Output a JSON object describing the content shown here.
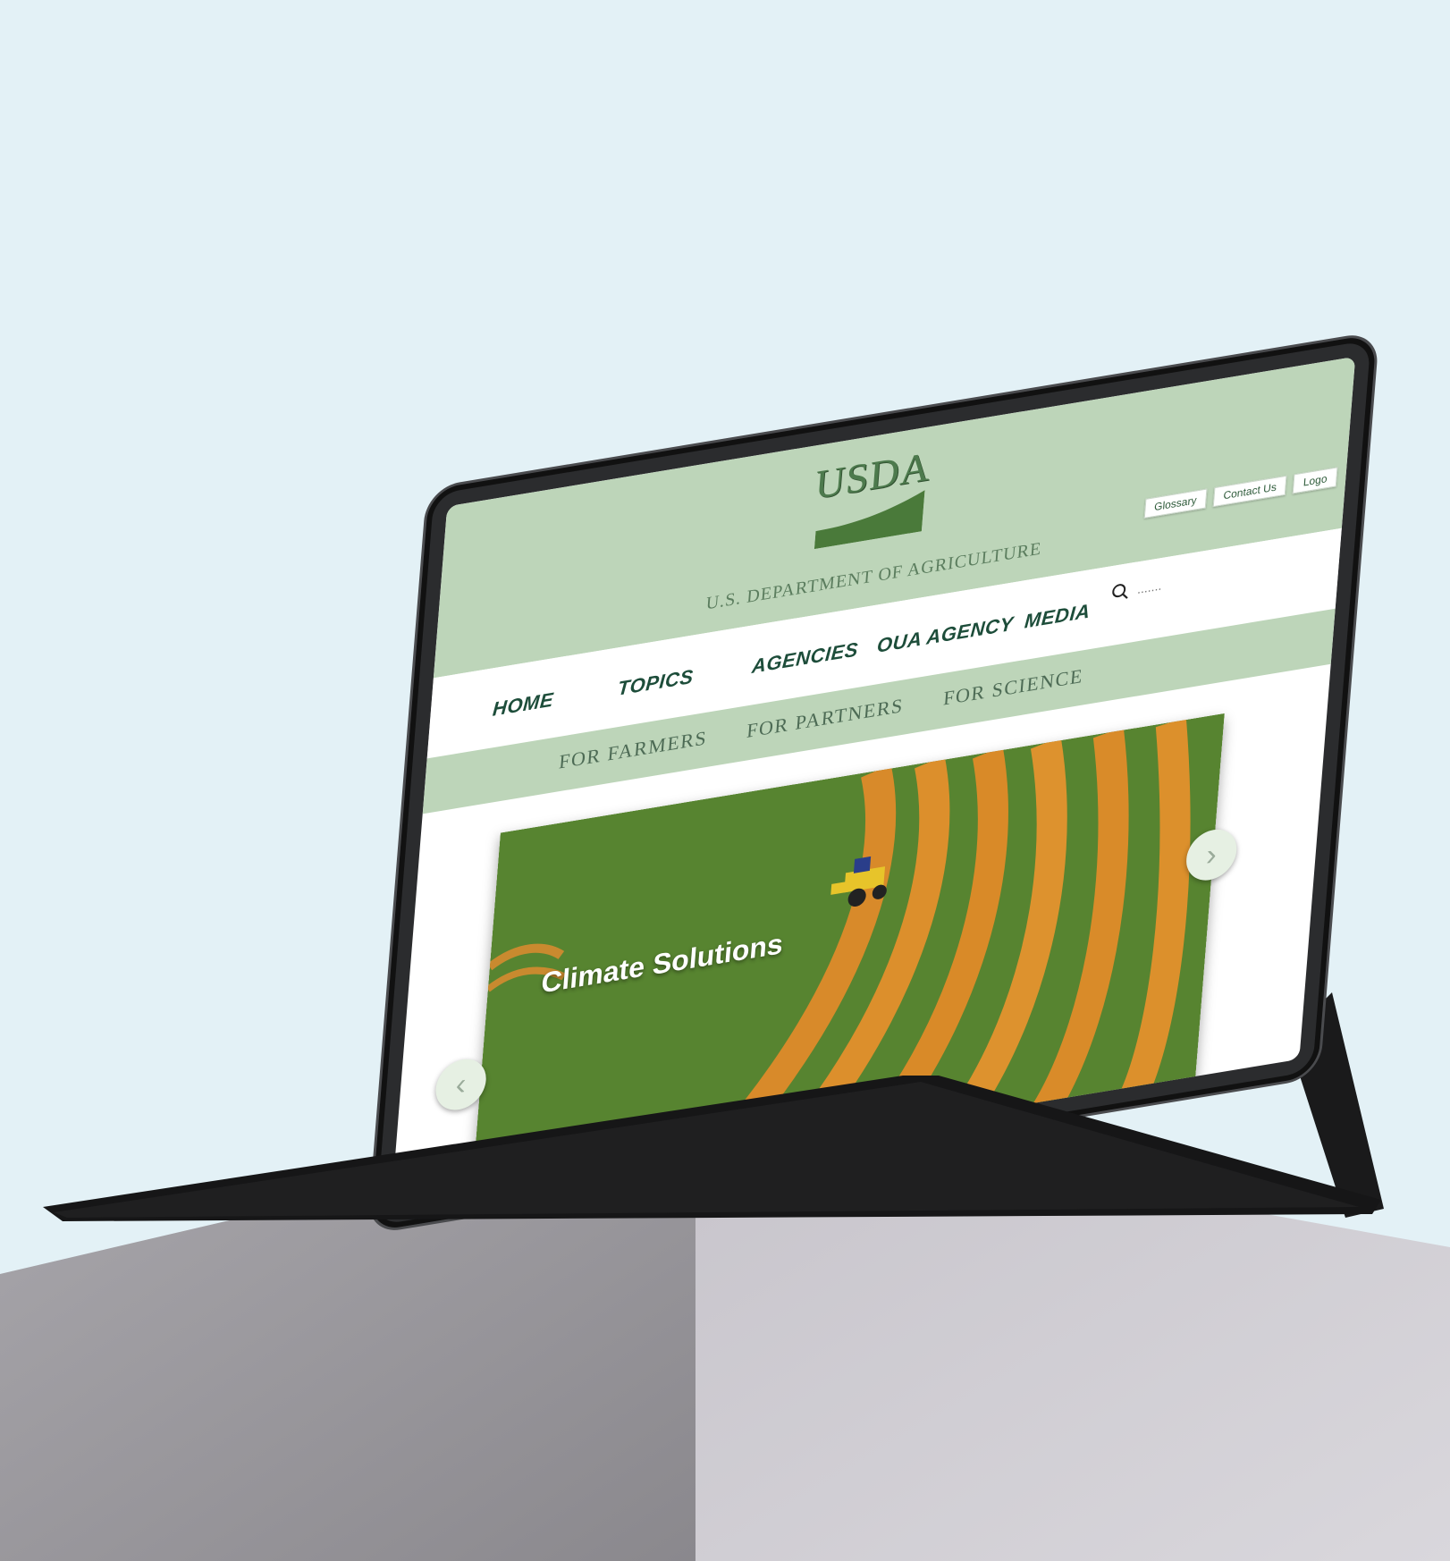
{
  "brand": {
    "logo_text": "USDA",
    "department": "U.S. DEPARTMENT OF AGRICULTURE"
  },
  "utility_links": [
    "Glossary",
    "Contact Us",
    "Logo"
  ],
  "nav": {
    "items": [
      "HOME",
      "TOPICS",
      "AGENCIES",
      "OUA AGENCY",
      "MEDIA"
    ]
  },
  "search": {
    "placeholder": "......."
  },
  "subnav": {
    "items": [
      "FOR FARMERS",
      "FOR PARTNERS",
      "FOR SCIENCE"
    ]
  },
  "hero": {
    "title": "Climate Solutions",
    "prev_symbol": "‹",
    "next_symbol": "›"
  },
  "colors": {
    "header_green": "#bdd5b9",
    "nav_text": "#1d4d3a",
    "logo_green": "#4d7a4d",
    "background": "#e3f1f6"
  }
}
